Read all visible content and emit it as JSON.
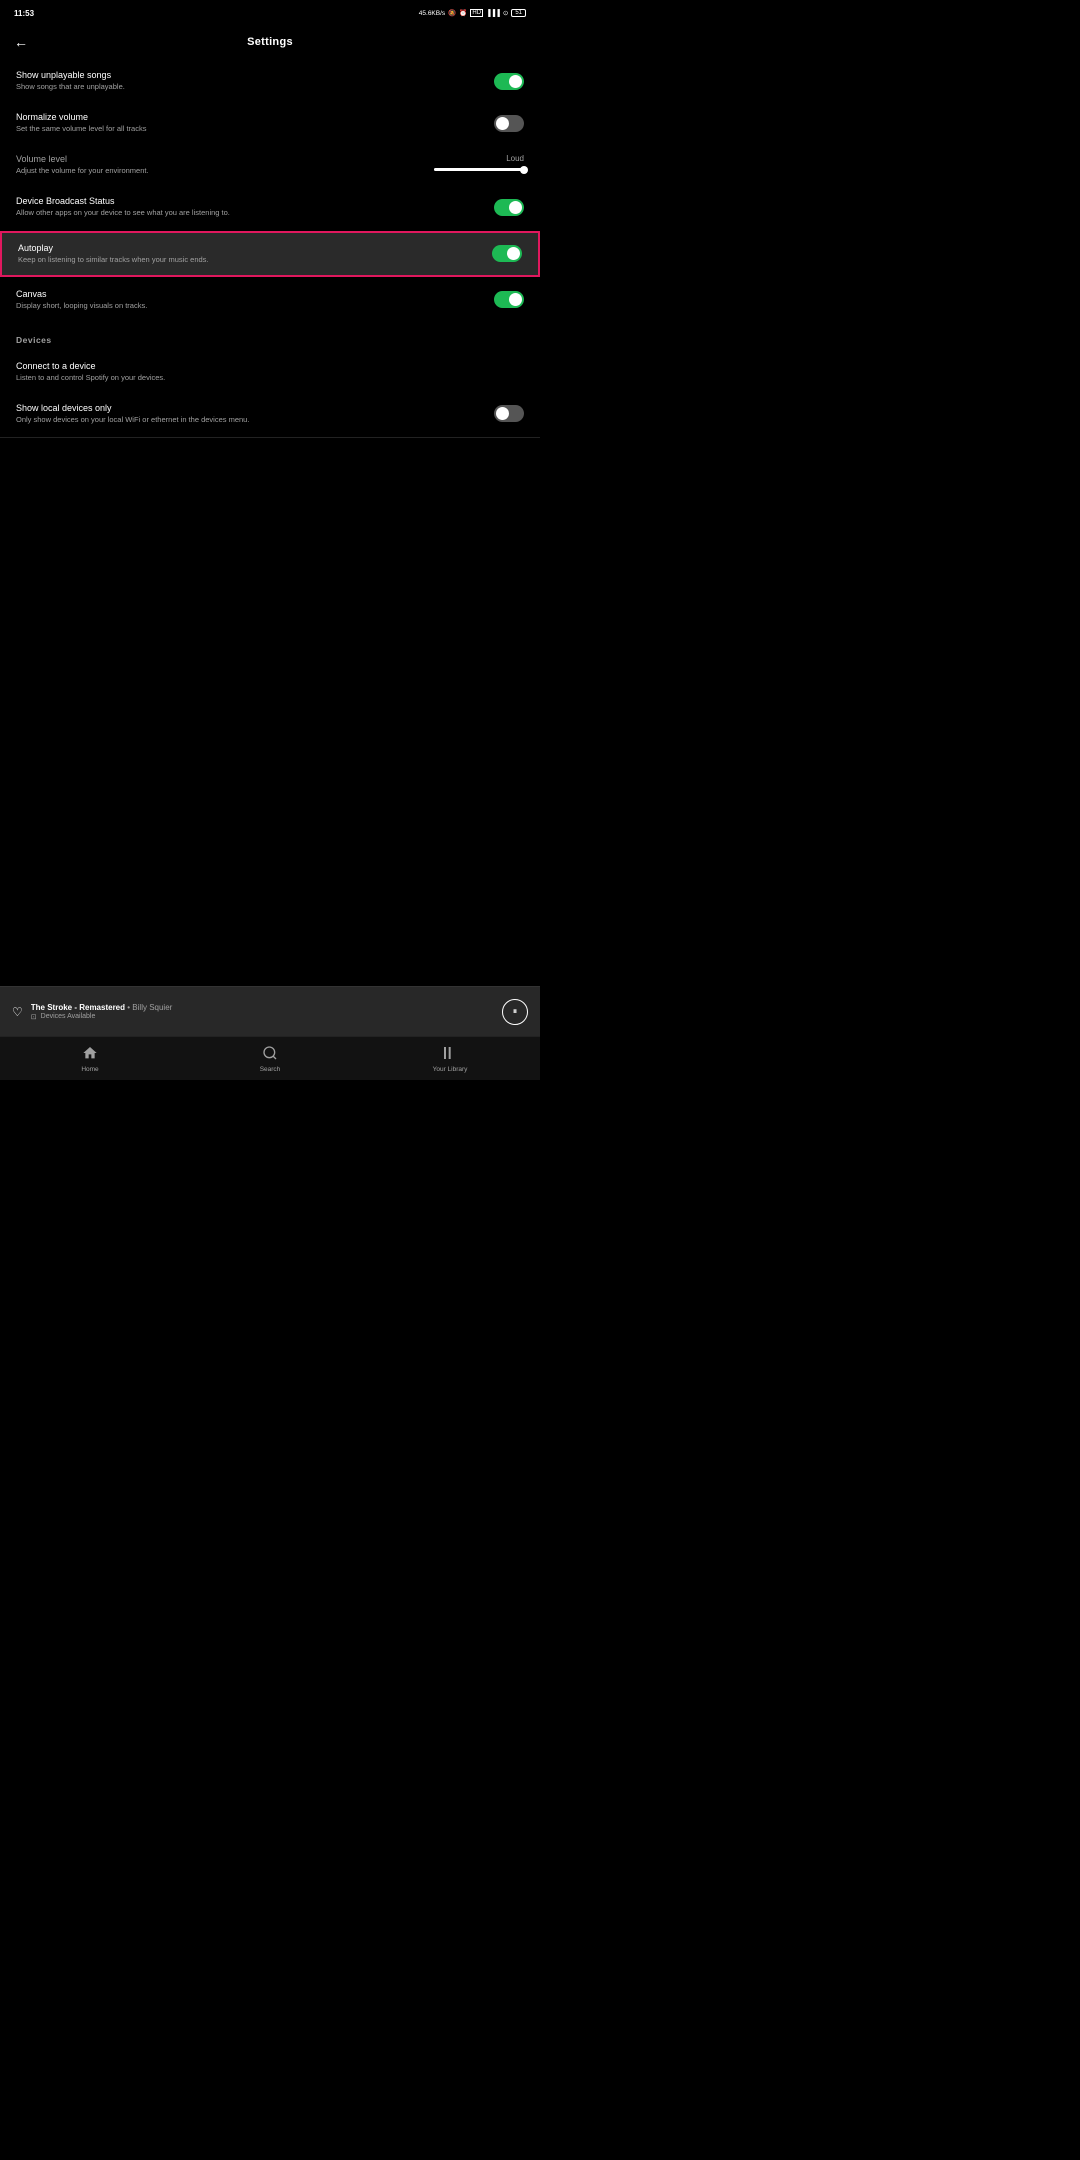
{
  "statusBar": {
    "time": "11:53",
    "networkSpeed": "45.6KB/s",
    "battery": "51"
  },
  "header": {
    "title": "Settings",
    "backLabel": "←"
  },
  "settings": [
    {
      "id": "show-unplayable",
      "label": "Show unplayable songs",
      "desc": "Show songs that are unplayable.",
      "type": "toggle",
      "enabled": true,
      "highlighted": false
    },
    {
      "id": "normalize-volume",
      "label": "Normalize volume",
      "desc": "Set the same volume level for all tracks",
      "type": "toggle",
      "enabled": false,
      "highlighted": false
    },
    {
      "id": "volume-level",
      "label": "Volume level",
      "desc": "Adjust the volume for your environment.",
      "type": "value",
      "value": "Loud",
      "highlighted": false
    },
    {
      "id": "device-broadcast",
      "label": "Device Broadcast Status",
      "desc": "Allow other apps on your device to see what you are listening to.",
      "type": "toggle",
      "enabled": true,
      "highlighted": false
    },
    {
      "id": "autoplay",
      "label": "Autoplay",
      "desc": "Keep on listening to similar tracks when your music ends.",
      "type": "toggle",
      "enabled": true,
      "highlighted": true
    },
    {
      "id": "canvas",
      "label": "Canvas",
      "desc": "Display short, looping visuals on tracks.",
      "type": "toggle",
      "enabled": true,
      "highlighted": false
    }
  ],
  "devicesSection": {
    "label": "Devices",
    "items": [
      {
        "id": "connect-device",
        "label": "Connect to a device",
        "desc": "Listen to and control Spotify on your devices.",
        "type": "link"
      },
      {
        "id": "local-devices",
        "label": "Show local devices only",
        "desc": "Only show devices on your local WiFi or ethernet in the devices menu.",
        "type": "toggle",
        "enabled": false
      }
    ]
  },
  "miniPlayer": {
    "track": "The Stroke - Remastered",
    "artist": "Billy Squier",
    "subtitle": "Devices Available"
  },
  "bottomNav": [
    {
      "id": "home",
      "label": "Home",
      "icon": "⌂"
    },
    {
      "id": "search",
      "label": "Search",
      "icon": "○"
    },
    {
      "id": "library",
      "label": "Your Library",
      "icon": "⫴"
    }
  ]
}
